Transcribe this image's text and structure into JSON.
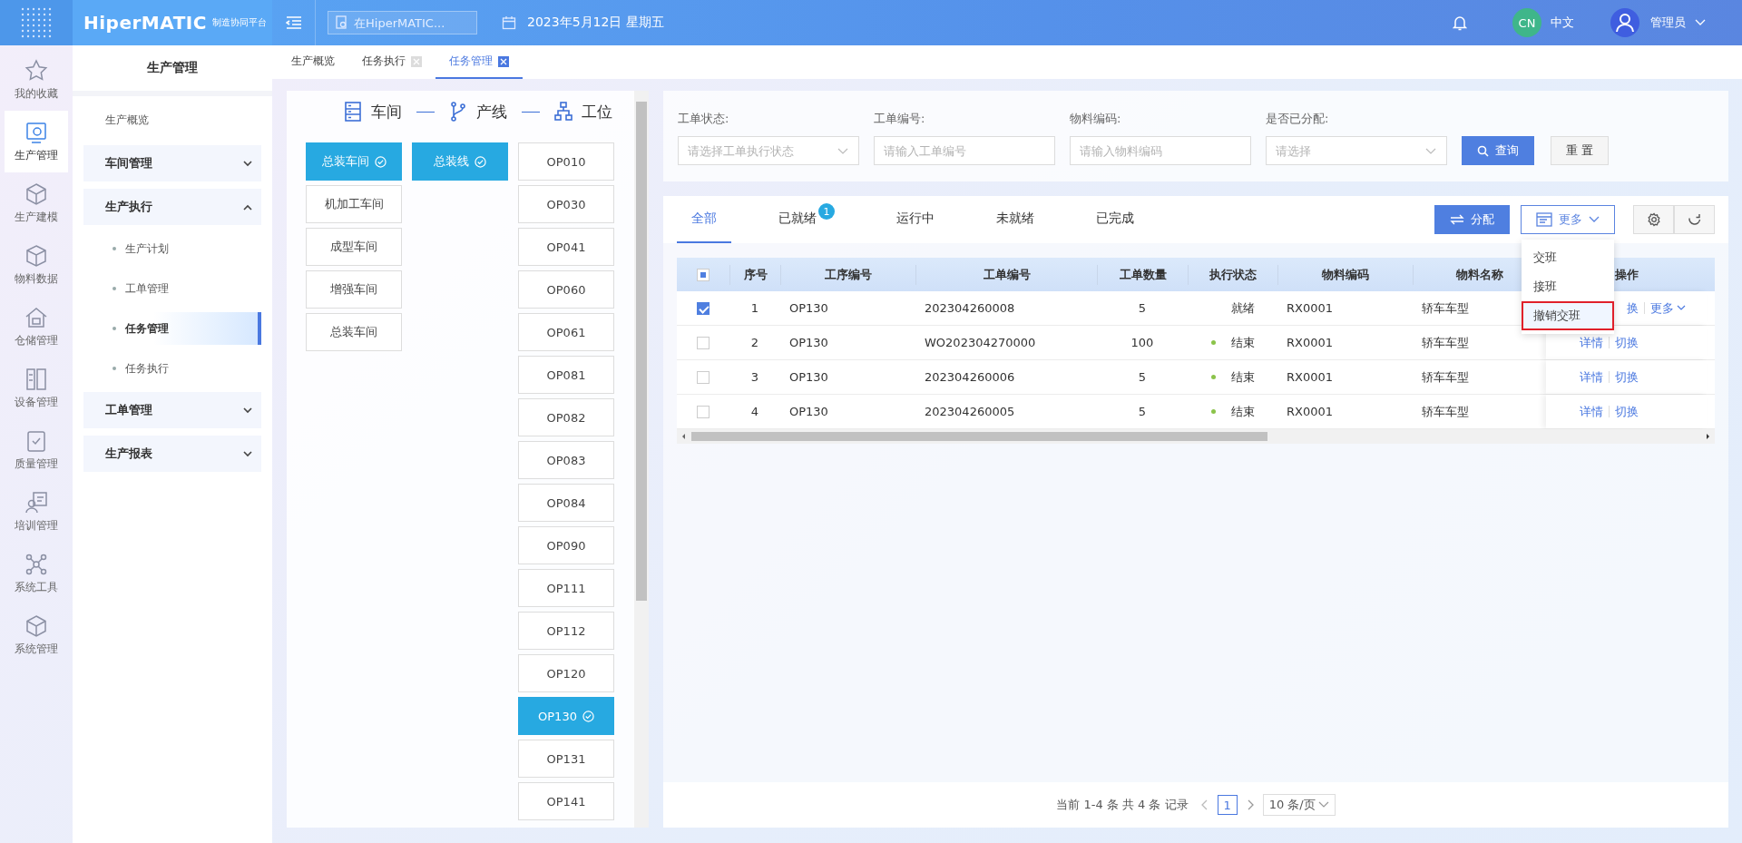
{
  "topbar": {
    "logo": "HiperMATIC",
    "logo_sub": "制造协同平台",
    "search": {
      "placeholder": "在HiperMATIC..."
    },
    "date": "2023年5月12日 星期五",
    "language_badge": "CN",
    "language": "中文",
    "user": "管理员"
  },
  "rail": [
    {
      "label": "我的收藏",
      "selected": false
    },
    {
      "label": "生产管理",
      "selected": true
    },
    {
      "label": "生产建模",
      "selected": false
    },
    {
      "label": "物料数据",
      "selected": false
    },
    {
      "label": "仓储管理",
      "selected": false
    },
    {
      "label": "设备管理",
      "selected": false
    },
    {
      "label": "质量管理",
      "selected": false
    },
    {
      "label": "培训管理",
      "selected": false
    },
    {
      "label": "系统工具",
      "selected": false
    },
    {
      "label": "系统管理",
      "selected": false
    }
  ],
  "subnav": {
    "title": "生产管理",
    "items": [
      {
        "label": "生产概览",
        "kind": "link"
      },
      {
        "label": "车间管理",
        "kind": "group",
        "expanded": false
      },
      {
        "label": "生产执行",
        "kind": "group",
        "expanded": true,
        "children": [
          {
            "label": "生产计划",
            "selected": false
          },
          {
            "label": "工单管理",
            "selected": false
          },
          {
            "label": "任务管理",
            "selected": true
          },
          {
            "label": "任务执行",
            "selected": false
          }
        ]
      },
      {
        "label": "工单管理",
        "kind": "group",
        "expanded": false
      },
      {
        "label": "生产报表",
        "kind": "group",
        "expanded": false
      }
    ]
  },
  "page_tabs": [
    {
      "label": "生产概览",
      "closable": false,
      "selected": false
    },
    {
      "label": "任务执行",
      "closable": true,
      "selected": false
    },
    {
      "label": "任务管理",
      "closable": true,
      "selected": true
    }
  ],
  "selector": {
    "headings": [
      "车间",
      "产线",
      "工位"
    ],
    "workshops": [
      {
        "label": "总装车间",
        "selected": true
      },
      {
        "label": "机加工车间",
        "selected": false
      },
      {
        "label": "成型车间",
        "selected": false
      },
      {
        "label": "增强车间",
        "selected": false
      },
      {
        "label": "总装车间",
        "selected": false
      }
    ],
    "lines": [
      {
        "label": "总装线",
        "selected": true
      }
    ],
    "stations": [
      {
        "label": "OP010",
        "selected": false
      },
      {
        "label": "OP030",
        "selected": false
      },
      {
        "label": "OP041",
        "selected": false
      },
      {
        "label": "OP060",
        "selected": false
      },
      {
        "label": "OP061",
        "selected": false
      },
      {
        "label": "OP081",
        "selected": false
      },
      {
        "label": "OP082",
        "selected": false
      },
      {
        "label": "OP083",
        "selected": false
      },
      {
        "label": "OP084",
        "selected": false
      },
      {
        "label": "OP090",
        "selected": false
      },
      {
        "label": "OP111",
        "selected": false
      },
      {
        "label": "OP112",
        "selected": false
      },
      {
        "label": "OP120",
        "selected": false
      },
      {
        "label": "OP130",
        "selected": true
      },
      {
        "label": "OP131",
        "selected": false
      },
      {
        "label": "OP141",
        "selected": false
      }
    ]
  },
  "filters": [
    {
      "label": "工单状态:",
      "kind": "select",
      "placeholder": "请选择工单执行状态"
    },
    {
      "label": "工单编号:",
      "kind": "input",
      "placeholder": "请输入工单编号"
    },
    {
      "label": "物料编码:",
      "kind": "input",
      "placeholder": "请输入物料编码"
    },
    {
      "label": "是否已分配:",
      "kind": "select",
      "placeholder": "请选择"
    }
  ],
  "filter_buttons": [
    {
      "label": "查询",
      "kind": "primary"
    },
    {
      "label": "重 置",
      "kind": "plain"
    }
  ],
  "status_tabs": [
    {
      "label": "全部",
      "selected": true
    },
    {
      "label": "已就绪",
      "badge": "1",
      "selected": false
    },
    {
      "label": "运行中",
      "selected": false
    },
    {
      "label": "未就绪",
      "selected": false
    },
    {
      "label": "已完成",
      "selected": false
    }
  ],
  "toolbar": {
    "assign": "分配",
    "more": "更多"
  },
  "more_menu": [
    {
      "label": "交班",
      "selected": false
    },
    {
      "label": "接班",
      "selected": false
    },
    {
      "label": "撤销交班",
      "selected": true
    }
  ],
  "table": {
    "select_all_indeterminate": true,
    "columns": [
      "序号",
      "工序编号",
      "工单编号",
      "工单数量",
      "执行状态",
      "物料编码",
      "物料名称",
      "操作"
    ],
    "rows": [
      {
        "checked": true,
        "cells": [
          "1",
          "OP130",
          "202304260008",
          "5",
          "就绪",
          "RX0001",
          "轿车车型"
        ],
        "actions": [
          {
            "label": "换",
            "kind": "link"
          },
          {
            "label": "更多",
            "kind": "more"
          }
        ]
      },
      {
        "checked": false,
        "color": "#8bc34a",
        "cells": [
          "2",
          "OP130",
          "WO202304270000",
          "100",
          "结束",
          "RX0001",
          "轿车车型"
        ],
        "actions": [
          {
            "label": "详情",
            "kind": "link"
          },
          {
            "label": "切换",
            "kind": "link"
          }
        ]
      },
      {
        "checked": false,
        "color": "#8bc34a",
        "cells": [
          "3",
          "OP130",
          "202304260006",
          "5",
          "结束",
          "RX0001",
          "轿车车型"
        ],
        "actions": [
          {
            "label": "详情",
            "kind": "link"
          },
          {
            "label": "切换",
            "kind": "link"
          }
        ]
      },
      {
        "checked": false,
        "color": "#8bc34a",
        "cells": [
          "4",
          "OP130",
          "202304260005",
          "5",
          "结束",
          "RX0001",
          "轿车车型"
        ],
        "actions": [
          {
            "label": "详情",
            "kind": "link"
          },
          {
            "label": "切换",
            "kind": "link"
          }
        ]
      }
    ]
  },
  "pagination": {
    "summary": "当前 1-4 条 共 4 条 记录",
    "pages": [
      {
        "label": "1",
        "selected": true
      }
    ],
    "page_size": "10 条/页"
  }
}
